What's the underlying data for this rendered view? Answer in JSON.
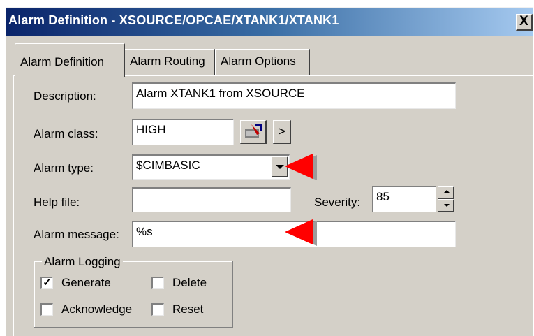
{
  "window": {
    "title": "Alarm Definition - XSOURCE/OPCAE/XTANK1/XTANK1",
    "close_glyph": "X"
  },
  "tabs": [
    {
      "label": "Alarm Definition",
      "active": true
    },
    {
      "label": "Alarm Routing",
      "active": false
    },
    {
      "label": "Alarm Options",
      "active": false
    }
  ],
  "form": {
    "description": {
      "label": "Description:",
      "value": "Alarm XTANK1 from XSOURCE"
    },
    "alarm_class": {
      "label": "Alarm class:",
      "value": "HIGH",
      "browse_glyph": ">"
    },
    "alarm_type": {
      "label": "Alarm type:",
      "value": "$CIMBASIC"
    },
    "help_file": {
      "label": "Help file:",
      "value": ""
    },
    "severity": {
      "label": "Severity:",
      "value": "85"
    },
    "alarm_message": {
      "label": "Alarm message:",
      "value": "%s"
    }
  },
  "alarm_logging": {
    "legend": "Alarm Logging",
    "options": [
      {
        "label": "Generate",
        "checked": true
      },
      {
        "label": "Delete",
        "checked": false
      },
      {
        "label": "Acknowledge",
        "checked": false
      },
      {
        "label": "Reset",
        "checked": false
      }
    ]
  },
  "colors": {
    "titlebar_start": "#0a246a",
    "titlebar_end": "#a6caf0",
    "dialog_face": "#d4d0c8",
    "annotation_arrow": "#ff0000"
  },
  "icons": {
    "class_editor": "alarm-class-editor-icon",
    "dropdown": "chevron-down-icon",
    "spin_up": "spin-up-icon",
    "spin_down": "spin-down-icon"
  }
}
